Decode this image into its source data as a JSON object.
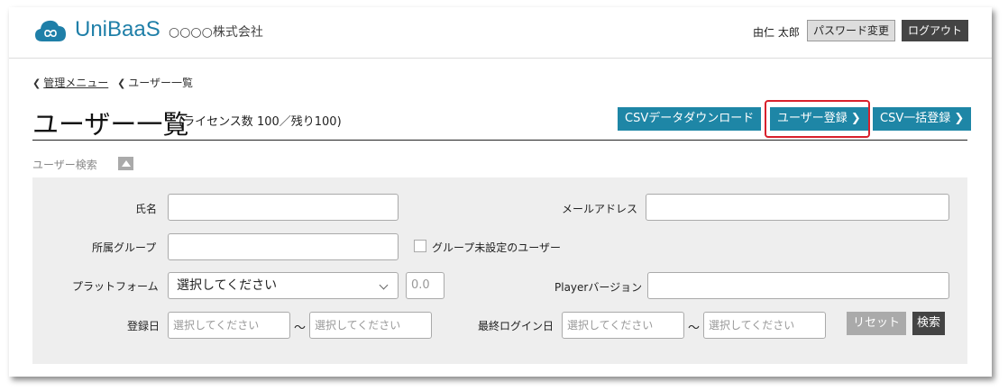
{
  "header": {
    "logo_text": "UniBaaS",
    "company": "○○○○株式会社",
    "user_name": "由仁 太郎",
    "password_change_label": "パスワード変更",
    "logout_label": "ログアウト"
  },
  "breadcrumb": {
    "items": [
      "管理メニュー",
      "ユーザー一覧"
    ]
  },
  "page": {
    "title": "ユーザー一覧",
    "license_info": "(ライセンス数 100／残り100)"
  },
  "actions": {
    "csv_download": "CSVデータダウンロード",
    "register_user": "ユーザー登録 ❯",
    "csv_bulk_register": "CSV一括登録 ❯"
  },
  "search": {
    "section_label": "ユーザー検索",
    "name_label": "氏名",
    "email_label": "メールアドレス",
    "group_label": "所属グループ",
    "ungrouped_label": "グループ未設定のユーザー",
    "platform_label": "プラットフォーム",
    "platform_selected": "選択してください",
    "platform_version_placeholder": "0.0",
    "player_version_label": "Playerバージョン",
    "registered_date_label": "登録日",
    "date_placeholder": "選択してください",
    "last_login_label": "最終ログイン日",
    "range_separator": "～",
    "reset_label": "リセット",
    "search_label": "検索"
  },
  "colors": {
    "accent": "#1e86a6",
    "highlight": "#d8202c",
    "brand": "#1f7fa8"
  }
}
